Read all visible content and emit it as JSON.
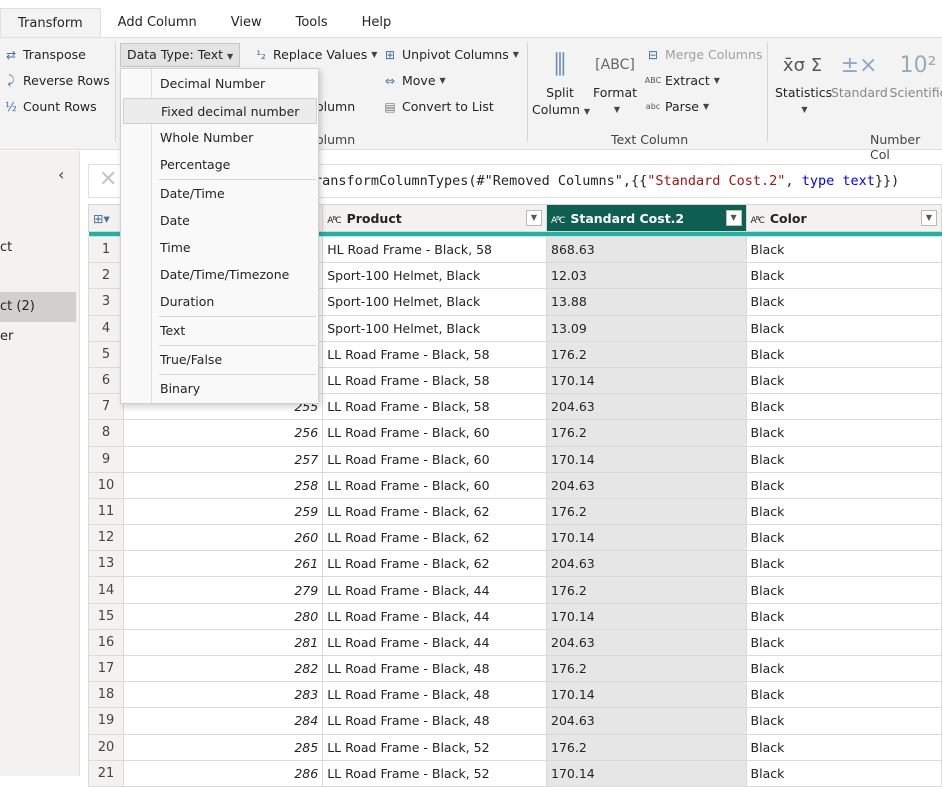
{
  "tabs": [
    "Transform",
    "Add Column",
    "View",
    "Tools",
    "Help"
  ],
  "active_tab": "Transform",
  "ribbon": {
    "table_group": [
      "Transpose",
      "Reverse Rows",
      "Count Rows"
    ],
    "data_type_button": "Data Type: Text",
    "replace_values": "Replace Values",
    "unpivot_columns": "Unpivot Columns",
    "move": "Move",
    "convert_to_list": "Convert to List",
    "partial_column_1": "olumn",
    "partial_column_2": "olumn",
    "any_column_label": "olumn",
    "split_column": [
      "Split",
      "Column"
    ],
    "format": "Format",
    "merge_columns": "Merge Columns",
    "extract": "Extract",
    "parse": "Parse",
    "text_column_label": "Text Column",
    "statistics": "Statistics",
    "standard": "Standard",
    "scientific": "Scientific",
    "number_column_label": "Number Col"
  },
  "data_type_menu": {
    "items": [
      "Decimal Number",
      "Fixed decimal number",
      "Whole Number",
      "Percentage",
      "Date/Time",
      "Date",
      "Time",
      "Date/Time/Timezone",
      "Duration",
      "Text",
      "True/False",
      "Binary"
    ],
    "highlighted": "Fixed decimal number"
  },
  "queries": {
    "items": [
      "ct",
      "ct (2)",
      "er"
    ],
    "selected": "ct (2)"
  },
  "formula": {
    "prefix": "ransformColumnTypes(#\"Removed Columns\",{{",
    "string": "\"Standard Cost.2\"",
    "mid": ", ",
    "keyword": "type text",
    "suffix": "}})"
  },
  "grid": {
    "columns": [
      "",
      "Product",
      "Standard Cost.2",
      "Color"
    ],
    "selected_column": "Standard Cost.2",
    "rows": [
      {
        "n": "1",
        "id": "",
        "product": "HL Road Frame - Black, 58",
        "cost": "868.63",
        "color": "Black"
      },
      {
        "n": "2",
        "id": "",
        "product": "Sport-100 Helmet, Black",
        "cost": "12.03",
        "color": "Black"
      },
      {
        "n": "3",
        "id": "",
        "product": "Sport-100 Helmet, Black",
        "cost": "13.88",
        "color": "Black"
      },
      {
        "n": "4",
        "id": "",
        "product": "Sport-100 Helmet, Black",
        "cost": "13.09",
        "color": "Black"
      },
      {
        "n": "5",
        "id": "",
        "product": "LL Road Frame - Black, 58",
        "cost": "176.2",
        "color": "Black"
      },
      {
        "n": "6",
        "id": "",
        "product": "LL Road Frame - Black, 58",
        "cost": "170.14",
        "color": "Black"
      },
      {
        "n": "7",
        "id": "255",
        "product": "LL Road Frame - Black, 58",
        "cost": "204.63",
        "color": "Black"
      },
      {
        "n": "8",
        "id": "256",
        "product": "LL Road Frame - Black, 60",
        "cost": "176.2",
        "color": "Black"
      },
      {
        "n": "9",
        "id": "257",
        "product": "LL Road Frame - Black, 60",
        "cost": "170.14",
        "color": "Black"
      },
      {
        "n": "10",
        "id": "258",
        "product": "LL Road Frame - Black, 60",
        "cost": "204.63",
        "color": "Black"
      },
      {
        "n": "11",
        "id": "259",
        "product": "LL Road Frame - Black, 62",
        "cost": "176.2",
        "color": "Black"
      },
      {
        "n": "12",
        "id": "260",
        "product": "LL Road Frame - Black, 62",
        "cost": "170.14",
        "color": "Black"
      },
      {
        "n": "13",
        "id": "261",
        "product": "LL Road Frame - Black, 62",
        "cost": "204.63",
        "color": "Black"
      },
      {
        "n": "14",
        "id": "279",
        "product": "LL Road Frame - Black, 44",
        "cost": "176.2",
        "color": "Black"
      },
      {
        "n": "15",
        "id": "280",
        "product": "LL Road Frame - Black, 44",
        "cost": "170.14",
        "color": "Black"
      },
      {
        "n": "16",
        "id": "281",
        "product": "LL Road Frame - Black, 44",
        "cost": "204.63",
        "color": "Black"
      },
      {
        "n": "17",
        "id": "282",
        "product": "LL Road Frame - Black, 48",
        "cost": "176.2",
        "color": "Black"
      },
      {
        "n": "18",
        "id": "283",
        "product": "LL Road Frame - Black, 48",
        "cost": "170.14",
        "color": "Black"
      },
      {
        "n": "19",
        "id": "284",
        "product": "LL Road Frame - Black, 48",
        "cost": "204.63",
        "color": "Black"
      },
      {
        "n": "20",
        "id": "285",
        "product": "LL Road Frame - Black, 52",
        "cost": "176.2",
        "color": "Black"
      },
      {
        "n": "21",
        "id": "286",
        "product": "LL Road Frame - Black, 52",
        "cost": "170.14",
        "color": "Black"
      }
    ]
  },
  "colors": {
    "selected_header": "#0f5e52",
    "quality_bar": "#1ab5a3",
    "selected_column_bg": "#e6e6e6"
  }
}
